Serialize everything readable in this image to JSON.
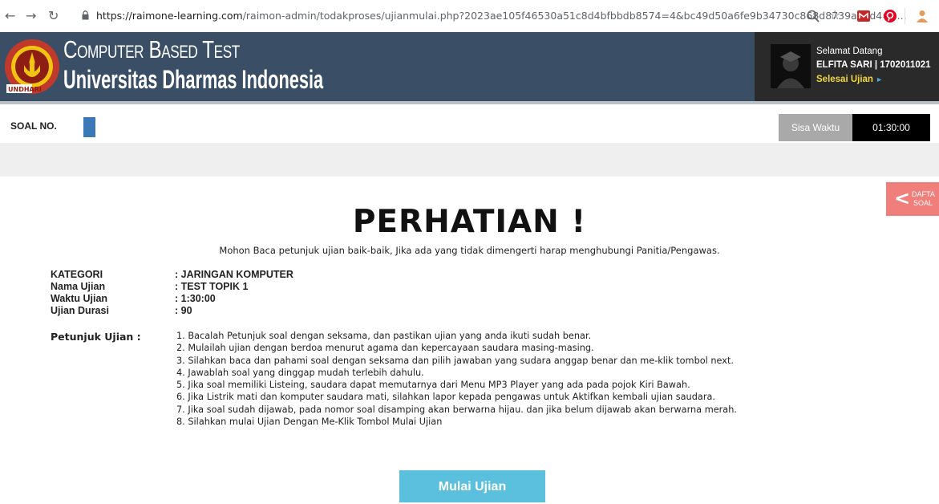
{
  "browser": {
    "url_domain": "https://raimone-learning.com",
    "url_path": "/raimon-admin/todakproses/ujianmulai.php?2023ae105f46530a51c8d4bfbbdb8574=4&bc49d50a6fe9b34730c868d8739aa8d4=3..."
  },
  "header": {
    "title_line1": "Computer Based Test",
    "title_line2": "Universitas Dharmas Indonesia",
    "logo_text_top": "Dharmas Indonesia",
    "logo_text_bottom": "UNDHARI"
  },
  "user": {
    "greeting": "Selamat Datang",
    "name_id": "ELFITA SARI | 1702011021",
    "finish_label": "Selesai Ujian",
    "finish_arrow": "►"
  },
  "soal": {
    "label": "SOAL NO."
  },
  "timer": {
    "label": "Sisa Waktu",
    "value": "01:30:00"
  },
  "daftar_soal": {
    "line1": "DAFTA",
    "line2": "SOAL"
  },
  "main": {
    "heading": "PERHATIAN !",
    "subheading": "Mohon Baca petunjuk ujian baik-baik, Jika ada yang tidak dimengerti harap menghubungi Panitia/Pengawas."
  },
  "info": [
    {
      "key": "KATEGORI",
      "value": ": JARINGAN KOMPUTER"
    },
    {
      "key": "Nama Ujian",
      "value": ": TEST TOPIK 1"
    },
    {
      "key": "Waktu Ujian",
      "value": ": 1:30:00"
    },
    {
      "key": "Ujian Durasi",
      "value": ": 90"
    }
  ],
  "petunjuk": {
    "label": "Petunjuk Ujian :",
    "items": [
      "1. Bacalah Petunjuk soal dengan seksama, dan pastikan ujian yang anda ikuti sudah benar.",
      "2. Mulailah ujian dengan berdoa menurut agama dan kepercayaan saudara masing-masing.",
      "3. Silahkan baca dan pahami soal dengan seksama dan pilih jawaban yang sudara anggap benar dan me-klik tombol next.",
      "4. Jawablah soal yang dinggap mudah terlebih dahulu.",
      "5. Jika soal memiliki Listeing, saudara dapat memutarnya dari Menu MP3 Player yang ada pada pojok Kiri Bawah.",
      "6. Jika Listrik mati dan komputer saudara mati, silahkan lapor kepada pengawas untuk Aktifkan kembali ujian saudara.",
      "7. Jika soal sudah dijawab, pada nomor soal disamping akan berwarna hijau. dan jika belum dijawab akan berwarna merah.",
      "8. Silahkan mulai Ujian Dengan Me-Klik Tombol Mulai Ujian"
    ]
  },
  "start_button": {
    "label": "Mulai Ujian"
  },
  "colors": {
    "header_bg": "#3a4e66",
    "user_panel_bg": "#2a2a2a",
    "soal_box": "#3b78b7",
    "start_button": "#5bc0de",
    "daftar_tab": "#f07f7c",
    "finish_label": "#f2d83c"
  }
}
